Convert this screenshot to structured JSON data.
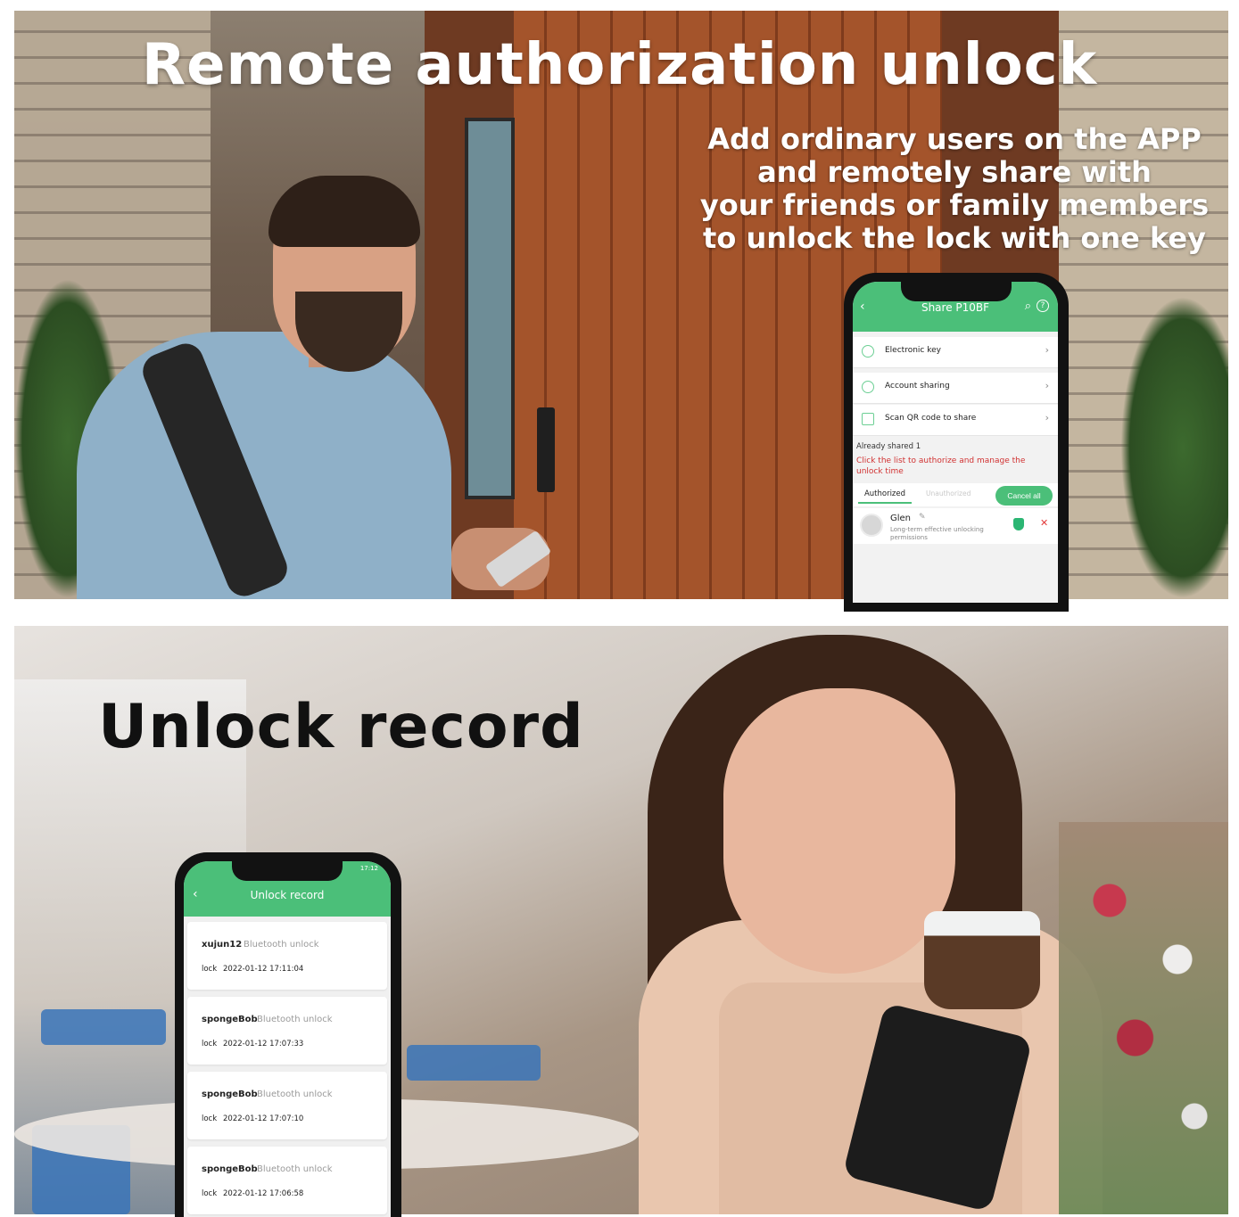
{
  "panel1": {
    "title": "Remote authorization unlock",
    "subtitle_lines": [
      "Add ordinary users on the APP",
      "and remotely share with",
      "your friends or family members",
      "to unlock the lock with one key"
    ]
  },
  "share_app": {
    "header_title": "Share P10BF",
    "back_icon": "‹",
    "search_icon": "⌕",
    "help_icon": "?",
    "menu": [
      {
        "label": "Electronic key",
        "chevron": "›"
      },
      {
        "label": "Account sharing",
        "chevron": "›"
      },
      {
        "label": "Scan QR code to share",
        "chevron": "›"
      }
    ],
    "already_shared": "Already shared 1",
    "hint": "Click the list to authorize and manage the unlock time",
    "tab_authorized": "Authorized",
    "tab_unauthorized": "Unauthorized",
    "cancel_all": "Cancel all",
    "user": {
      "name": "Glen",
      "edit_icon": "✎",
      "permission": "Long-term effective unlocking permissions",
      "remove_icon": "✕"
    },
    "accent_color": "#4bbf79"
  },
  "panel2": {
    "title": "Unlock record"
  },
  "record_app": {
    "status_time": "17:12",
    "back_icon": "‹",
    "header_title": "Unlock record",
    "records": [
      {
        "user": "xujun12",
        "method": "Bluetooth unlock",
        "type": "lock",
        "time": "2022-01-12 17:11:04"
      },
      {
        "user": "spongeBob",
        "method": "Bluetooth unlock",
        "type": "lock",
        "time": "2022-01-12 17:07:33"
      },
      {
        "user": "spongeBob",
        "method": "Bluetooth unlock",
        "type": "lock",
        "time": "2022-01-12 17:07:10"
      },
      {
        "user": "spongeBob",
        "method": "Bluetooth unlock",
        "type": "lock",
        "time": "2022-01-12 17:06:58"
      }
    ]
  }
}
